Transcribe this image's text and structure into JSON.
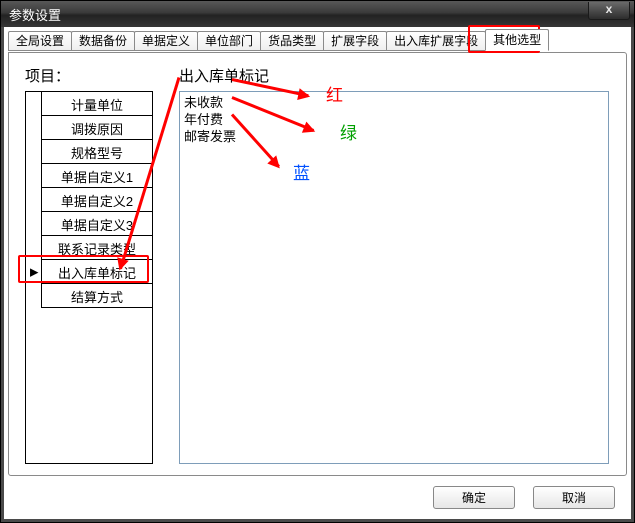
{
  "window": {
    "title": "参数设置",
    "close_label": "x"
  },
  "tabs": [
    {
      "label": "全局设置"
    },
    {
      "label": "数据备份"
    },
    {
      "label": "单据定义"
    },
    {
      "label": "单位部门"
    },
    {
      "label": "货品类型"
    },
    {
      "label": "扩展字段"
    },
    {
      "label": "出入库扩展字段"
    },
    {
      "label": "其他选型"
    }
  ],
  "active_tab_index": 7,
  "panel": {
    "project_header": "项目：",
    "mark_header": "出入库单标记",
    "project_items": [
      "计量单位",
      "调拨原因",
      "规格型号",
      "单据自定义1",
      "单据自定义2",
      "单据自定义3",
      "联系记录类型",
      "出入库单标记",
      "结算方式"
    ],
    "selected_project_index": 7,
    "list_items": [
      "未收款",
      "年付费",
      "邮寄发票"
    ]
  },
  "annotations": {
    "red_label": "红",
    "green_label": "绿",
    "blue_label": "蓝"
  },
  "buttons": {
    "ok": "确定",
    "cancel": "取消"
  }
}
